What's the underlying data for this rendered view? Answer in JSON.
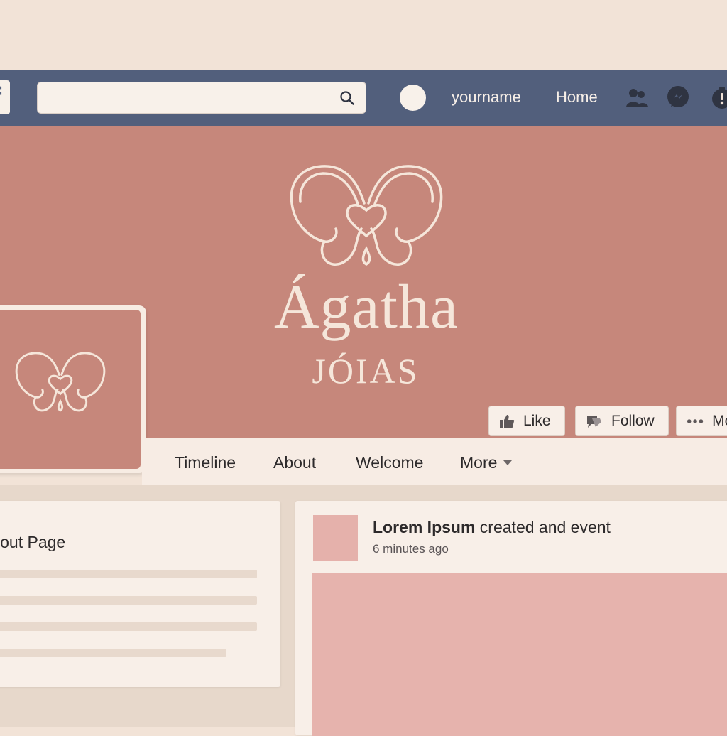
{
  "topbar": {
    "logo_letter": "f",
    "search": {
      "value": "",
      "placeholder": ""
    },
    "username": "yourname",
    "home_label": "Home",
    "icons": [
      "friends-icon",
      "messenger-icon",
      "notifications-icon"
    ]
  },
  "cover": {
    "brand_name": "Ágatha",
    "brand_subtitle": "JÓIAS"
  },
  "actions": {
    "like_label": "Like",
    "follow_label": "Follow",
    "more_label": "More"
  },
  "tabs": [
    {
      "label": "Timeline"
    },
    {
      "label": "About"
    },
    {
      "label": "Welcome"
    },
    {
      "label": "More"
    }
  ],
  "about_card": {
    "title": "About Page"
  },
  "post": {
    "author": "Lorem Ipsum",
    "action": " created and event",
    "time": "6 minutes ago"
  },
  "colors": {
    "topbar": "#525f7c",
    "cover": "#c6877b",
    "page_background": "#f2e3d7",
    "card": "#f8efe8",
    "post_image": "#e6b3ad"
  }
}
